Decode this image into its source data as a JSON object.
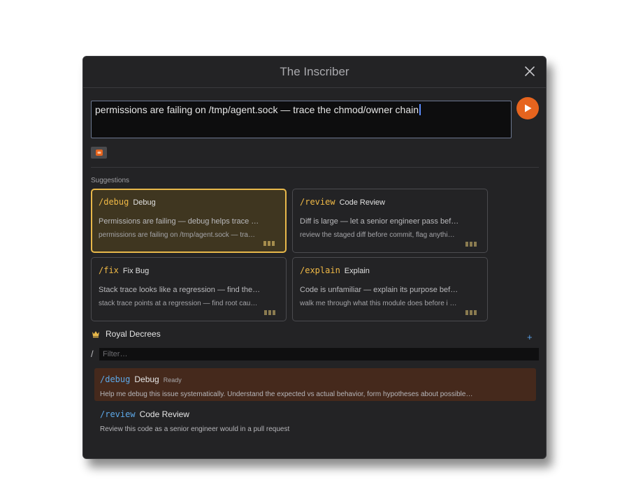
{
  "dialog": {
    "title": "The Inscriber",
    "close_icon": "close-icon"
  },
  "composer": {
    "text": "permissions are failing on /tmp/agent.sock — trace the chmod/owner chain",
    "send_icon": "play-arrow-icon",
    "attach_icon": "attachment-icon"
  },
  "suggestions": {
    "label": "Suggestions",
    "cards": [
      {
        "command": "/debug",
        "name": "Debug",
        "description": "Permissions are failing — debug helps trace …",
        "sample": "permissions are failing on /tmp/agent.sock — tra…",
        "selected": true
      },
      {
        "command": "/review",
        "name": "Code Review",
        "description": "Diff is large — let a senior engineer pass bef…",
        "sample": "review the staged diff before commit, flag anythi…",
        "selected": false
      },
      {
        "command": "/fix",
        "name": "Fix Bug",
        "description": "Stack trace looks like a regression — find the…",
        "sample": "stack trace points at a regression — find root cau…",
        "selected": false
      },
      {
        "command": "/explain",
        "name": "Explain",
        "description": "Code is unfamiliar — explain its purpose bef…",
        "sample": "walk me through what this module does before i …",
        "selected": false
      }
    ]
  },
  "decrees": {
    "icon": "crown-icon",
    "title": "Royal Decrees",
    "add_label": "+",
    "filter_prefix": "/",
    "filter_placeholder": "Filter…",
    "filter_value": "",
    "items": [
      {
        "command": "/debug",
        "name": "Debug",
        "status": "Ready",
        "description": "Help me debug this issue systematically. Understand the expected vs actual behavior, form hypotheses about possible…",
        "active": true
      },
      {
        "command": "/review",
        "name": "Code Review",
        "status": "",
        "description": "Review this code as a senior engineer would in a pull request",
        "active": false
      }
    ]
  },
  "colors": {
    "accent_orange": "#e6641e",
    "command_gold": "#f0b946",
    "command_blue": "#5da8e8",
    "selected_border": "#e8b84a"
  }
}
